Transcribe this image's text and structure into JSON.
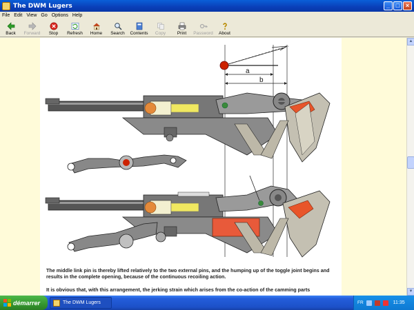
{
  "window": {
    "title": "The DWM Lugers",
    "app_icon": "help-book-icon"
  },
  "menu": {
    "items": [
      "File",
      "Edit",
      "View",
      "Go",
      "Options",
      "Help"
    ]
  },
  "toolbar": {
    "buttons": [
      {
        "label": "Back",
        "icon": "back-arrow-icon",
        "enabled": true
      },
      {
        "label": "Forward",
        "icon": "forward-arrow-icon",
        "enabled": false
      },
      {
        "label": "Stop",
        "icon": "stop-icon",
        "enabled": true
      },
      {
        "label": "Refresh",
        "icon": "refresh-icon",
        "enabled": true
      },
      {
        "label": "Home",
        "icon": "home-icon",
        "enabled": true
      },
      {
        "label": "Search",
        "icon": "search-icon",
        "enabled": true
      },
      {
        "label": "Contents",
        "icon": "contents-icon",
        "enabled": true
      },
      {
        "label": "Copy",
        "icon": "copy-icon",
        "enabled": false
      },
      {
        "label": "Print",
        "icon": "print-icon",
        "enabled": true
      },
      {
        "label": "Password",
        "icon": "password-icon",
        "enabled": false
      },
      {
        "label": "About",
        "icon": "about-icon",
        "enabled": true
      }
    ]
  },
  "content": {
    "diagram": {
      "label_a": "a",
      "label_b": "b"
    },
    "paragraph1": "The middle link pin is thereby lifted relatively to the two external pins, and the humping up of the toggle joint begins and results in the complete opening, because of the continuous recoiling action.",
    "paragraph2": "It is obvious that, with this arrangement, the jerking strain which arises from the co-action of the camming parts"
  },
  "taskbar": {
    "start_label": "démarrer",
    "task_label": "The DWM Lugers",
    "tray_lang": "FR",
    "clock": "11:35"
  },
  "colors": {
    "accent_red": "#e8552a",
    "pin_red": "#cc2200",
    "page_bg": "#fffbd9"
  }
}
